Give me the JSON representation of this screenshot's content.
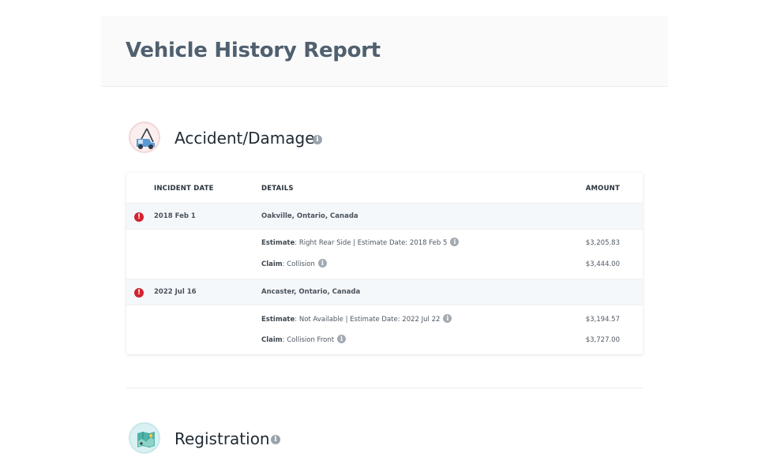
{
  "page": {
    "title": "Vehicle History Report"
  },
  "sections": {
    "accident": {
      "title": "Accident/Damage",
      "icon": "tow-truck-icon"
    },
    "registration": {
      "title": "Registration",
      "icon": "map-icon"
    }
  },
  "table": {
    "headers": {
      "date": "INCIDENT DATE",
      "details": "DETAILS",
      "amount": "AMOUNT"
    },
    "incidents": [
      {
        "date": "2018 Feb 1",
        "location": "Oakville, Ontario, Canada",
        "estimate_label": "Estimate",
        "estimate_text": "Right Rear Side | Estimate Date: 2018 Feb 5",
        "estimate_amount": "$3,205.83",
        "claim_label": "Claim",
        "claim_text": "Collision",
        "claim_amount": "$3,444.00"
      },
      {
        "date": "2022 Jul 16",
        "location": "Ancaster, Ontario, Canada",
        "estimate_label": "Estimate",
        "estimate_text": "Not Available | Estimate Date: 2022 Jul 22",
        "estimate_amount": "$3,194.57",
        "claim_label": "Claim",
        "claim_text": "Collision Front",
        "claim_amount": "$3,727.00"
      }
    ]
  },
  "glyphs": {
    "info": "i",
    "alert": "!",
    "colon": ":"
  },
  "colors": {
    "title": "#50606f",
    "alert": "#d3232f",
    "row_highlight": "#f5f8fb"
  }
}
